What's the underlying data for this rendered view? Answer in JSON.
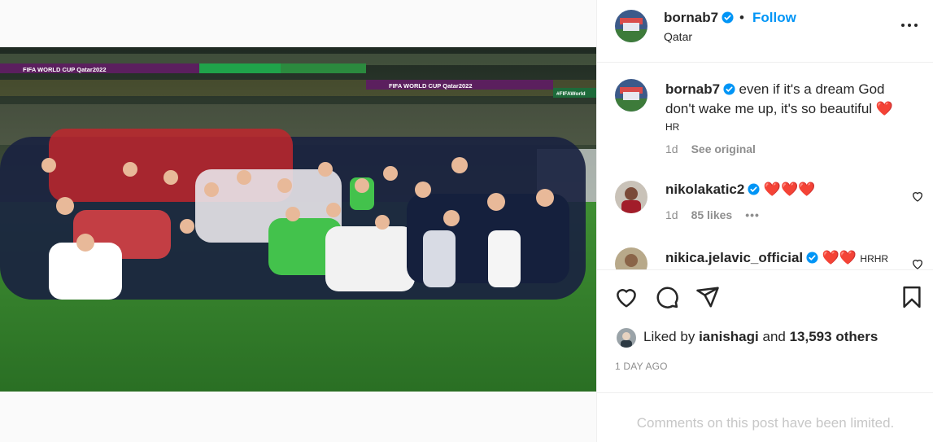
{
  "post": {
    "username": "bornab7",
    "follow_label": "Follow",
    "separator": "•",
    "location": "Qatar",
    "banner_left": "FIFA WORLD CUP Qatar2022",
    "banner_right": "FIFA WORLD CUP Qatar2022",
    "banner_far_right": "#FIFAWorld"
  },
  "comments": [
    {
      "username": "bornab7",
      "text": "even if it's a dream God don't wake me up, it's so beautiful",
      "emoji": "❤️",
      "translation_tag": "HR",
      "age": "1d",
      "action": "See original"
    },
    {
      "username": "nikolakatic2",
      "text": "",
      "emoji": "❤️❤️❤️",
      "age": "1d",
      "likes": "85 likes",
      "more": "•••"
    },
    {
      "username": "nikica.jelavic_official",
      "emoji": "❤️❤️",
      "suffix": "HRHR"
    }
  ],
  "footer": {
    "liked_prefix": "Liked by",
    "liked_user": "ianishagi",
    "liked_and": "and",
    "liked_others": "13,593 others",
    "timestamp": "1 DAY AGO",
    "limited_text": "Comments on this post have been limited."
  },
  "colors": {
    "accent": "#0095f6",
    "verified": "#0095f6",
    "heart": "#ed4956",
    "pitch": "#2f7d2a"
  }
}
